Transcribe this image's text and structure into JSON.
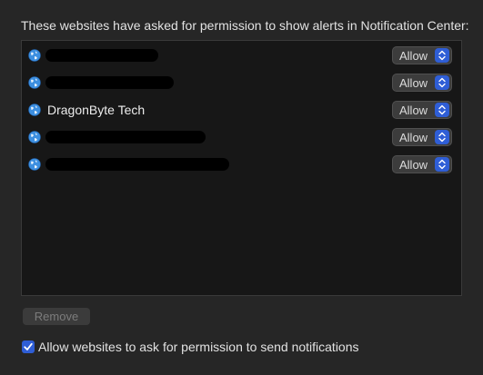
{
  "header": {
    "text": "These websites have asked for permission to show alerts in Notification Center:"
  },
  "sites": [
    {
      "name": "",
      "redacted": true,
      "permission": "Allow"
    },
    {
      "name": "",
      "redacted": true,
      "permission": "Allow"
    },
    {
      "name": "DragonByte Tech",
      "redacted": false,
      "permission": "Allow"
    },
    {
      "name": "",
      "redacted": true,
      "permission": "Allow"
    },
    {
      "name": "",
      "redacted": true,
      "permission": "Allow"
    }
  ],
  "icons": {
    "site": "globe-icon",
    "stepper": "up-down-chevron-icon",
    "check": "checkmark-icon"
  },
  "colors": {
    "accent": "#2f5ed6"
  },
  "footer": {
    "remove_label": "Remove",
    "checkbox_checked": true,
    "checkbox_label": "Allow websites to ask for permission to send notifications"
  }
}
